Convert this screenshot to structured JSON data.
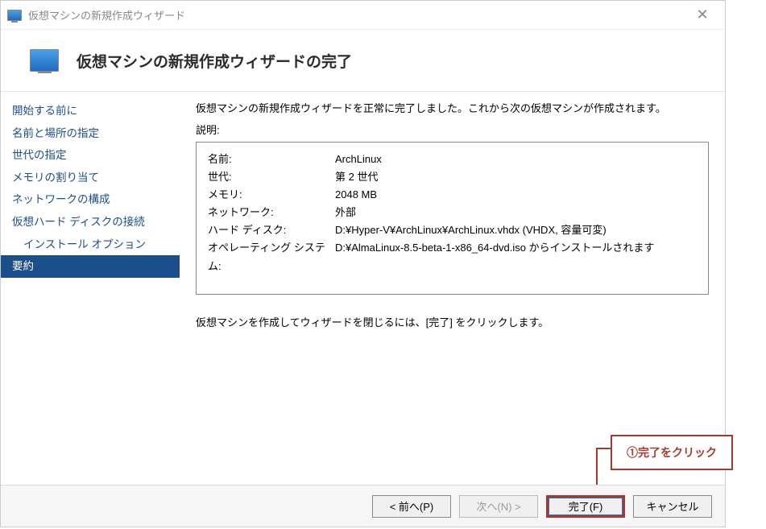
{
  "titlebar": {
    "title": "仮想マシンの新規作成ウィザード"
  },
  "header": {
    "title": "仮想マシンの新規作成ウィザードの完了"
  },
  "sidebar": {
    "items": [
      "開始する前に",
      "名前と場所の指定",
      "世代の指定",
      "メモリの割り当て",
      "ネットワークの構成",
      "仮想ハード ディスクの接続",
      "インストール オプション",
      "要約"
    ]
  },
  "main": {
    "intro": "仮想マシンの新規作成ウィザードを正常に完了しました。これから次の仮想マシンが作成されます。",
    "desc_label": "説明:",
    "summary": [
      {
        "key": "名前:",
        "val": "ArchLinux"
      },
      {
        "key": "世代:",
        "val": "第 2 世代"
      },
      {
        "key": "メモリ:",
        "val": "2048 MB"
      },
      {
        "key": "ネットワーク:",
        "val": "外部"
      },
      {
        "key": "ハード ディスク:",
        "val": "D:¥Hyper-V¥ArchLinux¥ArchLinux.vhdx (VHDX, 容量可変)"
      },
      {
        "key": "オペレーティング システム:",
        "val": "D:¥AlmaLinux-8.5-beta-1-x86_64-dvd.iso からインストールされます"
      }
    ],
    "instruction": "仮想マシンを作成してウィザードを閉じるには、[完了] をクリックします。"
  },
  "annotation": {
    "text": "①完了をクリック"
  },
  "buttons": {
    "prev": "< 前へ(P)",
    "next": "次へ(N) >",
    "finish": "完了(F)",
    "cancel": "キャンセル"
  }
}
